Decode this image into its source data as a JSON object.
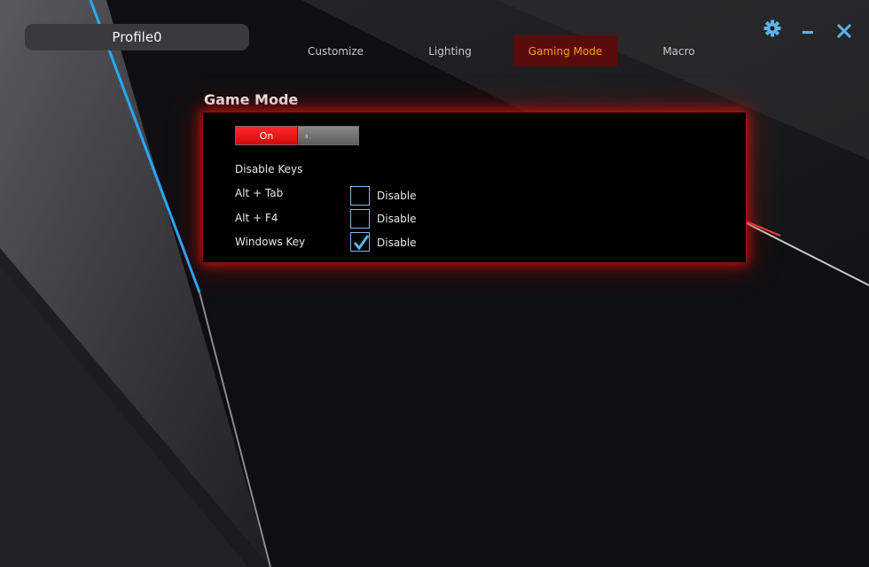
{
  "profile": {
    "name": "Profile0"
  },
  "tabs": [
    {
      "label": "Customize",
      "active": false
    },
    {
      "label": "Lighting",
      "active": false
    },
    {
      "label": "Gaming Mode",
      "active": true
    },
    {
      "label": "Macro",
      "active": false
    }
  ],
  "window_controls": {
    "icons": [
      "gear-icon",
      "minimize-icon",
      "close-icon"
    ],
    "color": "#5ab4f0"
  },
  "game_mode": {
    "title": "Game Mode",
    "toggle": {
      "on_label": "On",
      "state": "on"
    },
    "disable_keys_heading": "Disable Keys",
    "keys": [
      {
        "name": "Alt + Tab",
        "checkbox_label": "Disable",
        "checked": false
      },
      {
        "name": "Alt + F4",
        "checkbox_label": "Disable",
        "checked": false
      },
      {
        "name": "Windows Key",
        "checkbox_label": "Disable",
        "checked": true
      }
    ]
  },
  "colors": {
    "accent_red": "#e01414",
    "active_tab_text": "#ff9a1f",
    "active_tab_bg": "#5a0c0c",
    "checkbox_border": "#8ab4e0"
  }
}
